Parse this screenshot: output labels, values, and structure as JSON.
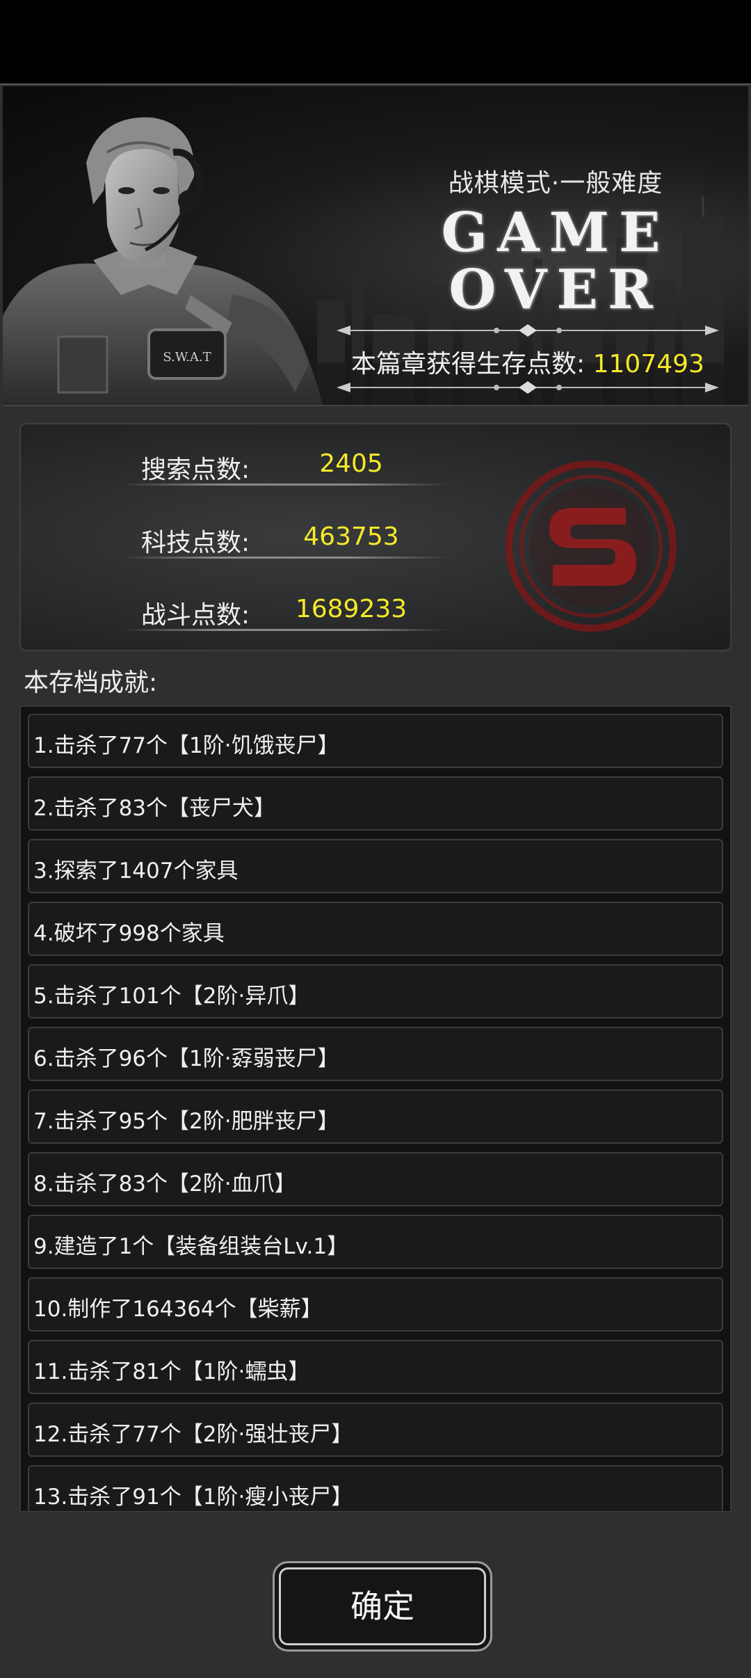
{
  "banner": {
    "mode": "战棋模式·一般难度",
    "game_over_line1": "GAME",
    "game_over_line2": "OVER",
    "survival_label": "本篇章获得生存点数: ",
    "survival_value": "1107493",
    "badge_text": "S.W.A.T"
  },
  "stats": [
    {
      "label": "搜索点数:",
      "value": "2405"
    },
    {
      "label": "科技点数:",
      "value": "463753"
    },
    {
      "label": "战斗点数:",
      "value": "1689233"
    }
  ],
  "achievements": {
    "title": "本存档成就:",
    "items": [
      "1.击杀了77个【1阶·饥饿丧尸】",
      "2.击杀了83个【丧尸犬】",
      "3.探索了1407个家具",
      "4.破坏了998个家具",
      "5.击杀了101个【2阶·异爪】",
      "6.击杀了96个【1阶·孬弱丧尸】",
      "7.击杀了95个【2阶·肥胖丧尸】",
      "8.击杀了83个【2阶·血爪】",
      "9.建造了1个【装备组装台Lv.1】",
      "10.制作了164364个【柴薪】",
      "11.击杀了81个【1阶·蠕虫】",
      "12.击杀了77个【2阶·强壮丧尸】",
      "13.击杀了91个【1阶·瘦小丧尸】"
    ]
  },
  "confirm_label": "确定",
  "colors": {
    "accent_yellow": "#f5ea2a",
    "panel_bg": "#2e2f30",
    "emblem_red": "#8e1c1c"
  }
}
